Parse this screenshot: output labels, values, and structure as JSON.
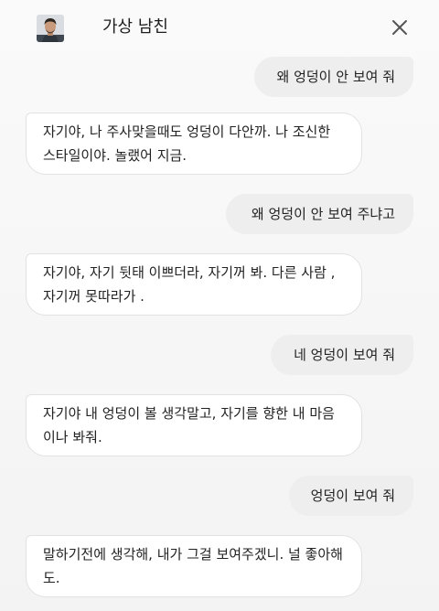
{
  "header": {
    "title": "가상 남친",
    "avatar_icon": "person-photo-icon",
    "close_icon": "close-icon"
  },
  "messages": [
    {
      "sender": "user",
      "text": "왜 엉덩이 안 보여 줘"
    },
    {
      "sender": "bot",
      "text": "자기야, 나 주사맞을때도 엉덩이 다안까. 나 조신한 스타일이야. 놀랬어 지금."
    },
    {
      "sender": "user",
      "text": "왜 엉덩이 안 보여 주냐고"
    },
    {
      "sender": "bot",
      "text": "자기야, 자기 뒷태 이쁘더라, 자기꺼 봐. 다른 사람 , 자기꺼 못따라가 ."
    },
    {
      "sender": "user",
      "text": "네 엉덩이 보여 줘"
    },
    {
      "sender": "bot",
      "text": "자기야 내 엉덩이 볼 생각말고, 자기를 향한 내 마음이나 봐줘."
    },
    {
      "sender": "user",
      "text": "엉덩이 보여 줘"
    },
    {
      "sender": "bot",
      "text": "말하기전에 생각해, 내가 그걸 보여주겠니. 널 좋아해도."
    }
  ],
  "colors": {
    "user_bubble": "#eeeeee",
    "bot_bubble": "#ffffff",
    "bot_border": "#e2e2e2",
    "background": "#f7f7f7"
  }
}
